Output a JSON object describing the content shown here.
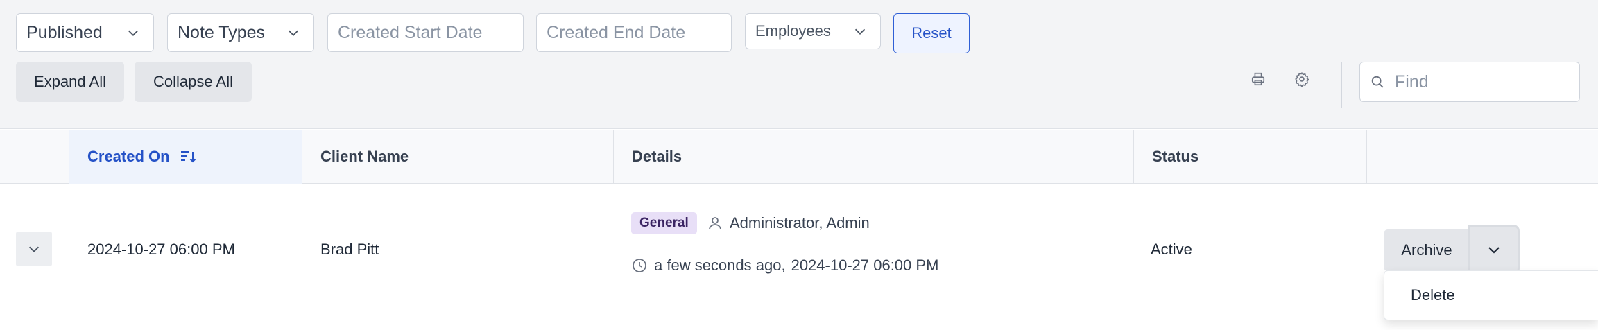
{
  "filters": {
    "status_select": "Published",
    "note_types_select": "Note Types",
    "created_start_placeholder": "Created Start Date",
    "created_end_placeholder": "Created End Date",
    "employees_select": "Employees",
    "reset_label": "Reset"
  },
  "actions": {
    "expand_all": "Expand All",
    "collapse_all": "Collapse All"
  },
  "search": {
    "placeholder": "Find"
  },
  "icons": {
    "print": "printer-icon",
    "settings": "gear-icon",
    "search": "search-icon",
    "sort": "sort-descending-icon",
    "user": "user-icon",
    "clock": "clock-icon",
    "chevron": "chevron-down-icon"
  },
  "colors": {
    "accent": "#2552c7",
    "badge_bg": "#e8dff7",
    "toolbar_bg": "#f3f4f6"
  },
  "table": {
    "columns": [
      "Created On",
      "Client Name",
      "Details",
      "Status"
    ],
    "rows": [
      {
        "created_on": "2024-10-27 06:00 PM",
        "client_name": "Brad Pitt",
        "note_type": "General",
        "author": "Administrator, Admin",
        "time_ago": "a few seconds ago,",
        "timestamp": "2024-10-27 06:00 PM",
        "status": "Active",
        "primary_action": "Archive",
        "menu_items": [
          "Delete"
        ]
      }
    ]
  }
}
